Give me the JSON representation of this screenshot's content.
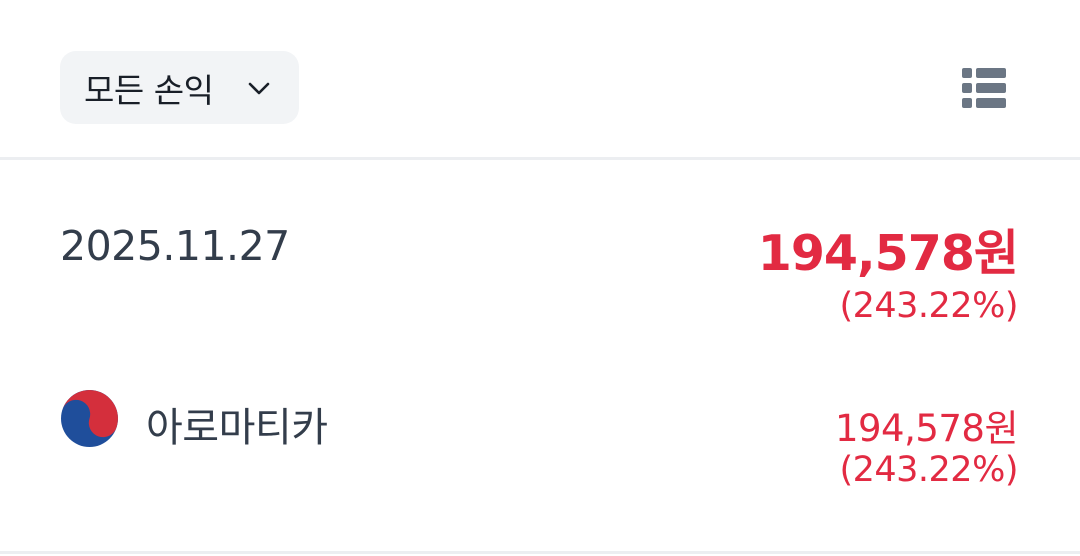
{
  "filter": {
    "label": "모든 손익",
    "icon": "chevron-down-icon"
  },
  "toolbar": {
    "list_view_icon": "list-icon"
  },
  "summary": {
    "date": "2025.11.27",
    "amount": "194,578원",
    "percent": "(243.22%)"
  },
  "stocks": [
    {
      "flag_icon": "korea-flag-icon",
      "name": "아로마티카",
      "amount": "194,578원",
      "percent": "(243.22%)"
    }
  ],
  "colors": {
    "profit_red": "#e22a42",
    "text_primary": "#333d4b",
    "chip_bg": "#f2f4f6",
    "icon_gray": "#6b7684",
    "flag_red": "#d42f3c",
    "flag_blue": "#1f4e9b"
  }
}
